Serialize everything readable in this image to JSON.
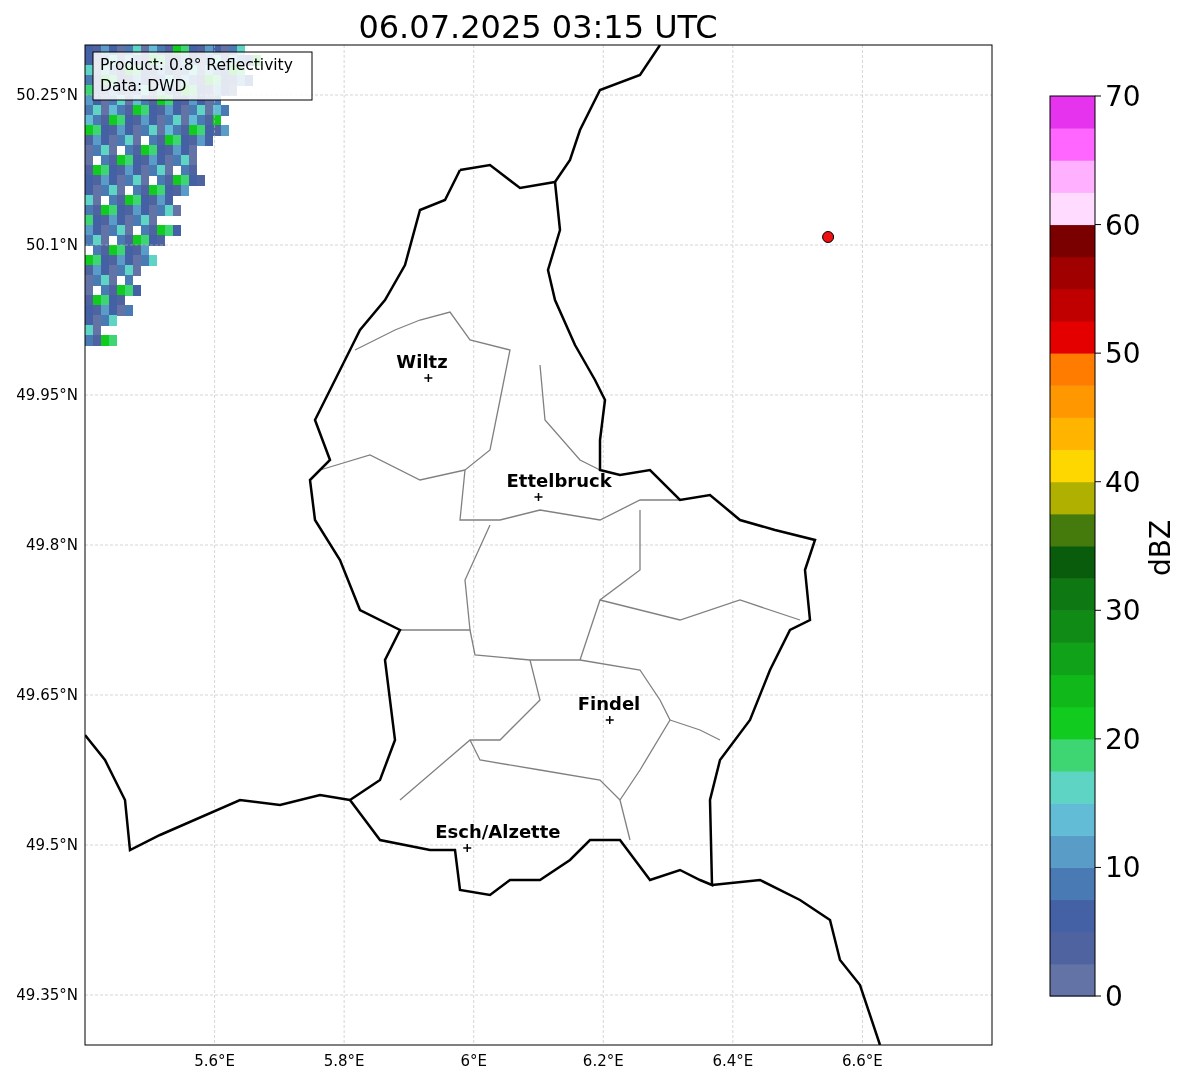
{
  "title": "06.07.2025 03:15 UTC",
  "map": {
    "info_lines": [
      "Product: 0.8° Reflectivity",
      "Data: DWD"
    ],
    "xticks": [
      "5.6°E",
      "5.8°E",
      "6°E",
      "6.2°E",
      "6.4°E",
      "6.6°E"
    ],
    "yticks": [
      "50.25°N",
      "50.1°N",
      "49.95°N",
      "49.8°N",
      "49.65°N",
      "49.5°N",
      "49.35°N"
    ],
    "cities": [
      {
        "name": "Wiltz"
      },
      {
        "name": "Ettelbruck"
      },
      {
        "name": "Findel"
      },
      {
        "name": "Esch/Alzette"
      }
    ]
  },
  "colorbar": {
    "label": "dBZ",
    "ticks": [
      "70",
      "60",
      "50",
      "40",
      "30",
      "20",
      "10",
      "0"
    ]
  }
}
